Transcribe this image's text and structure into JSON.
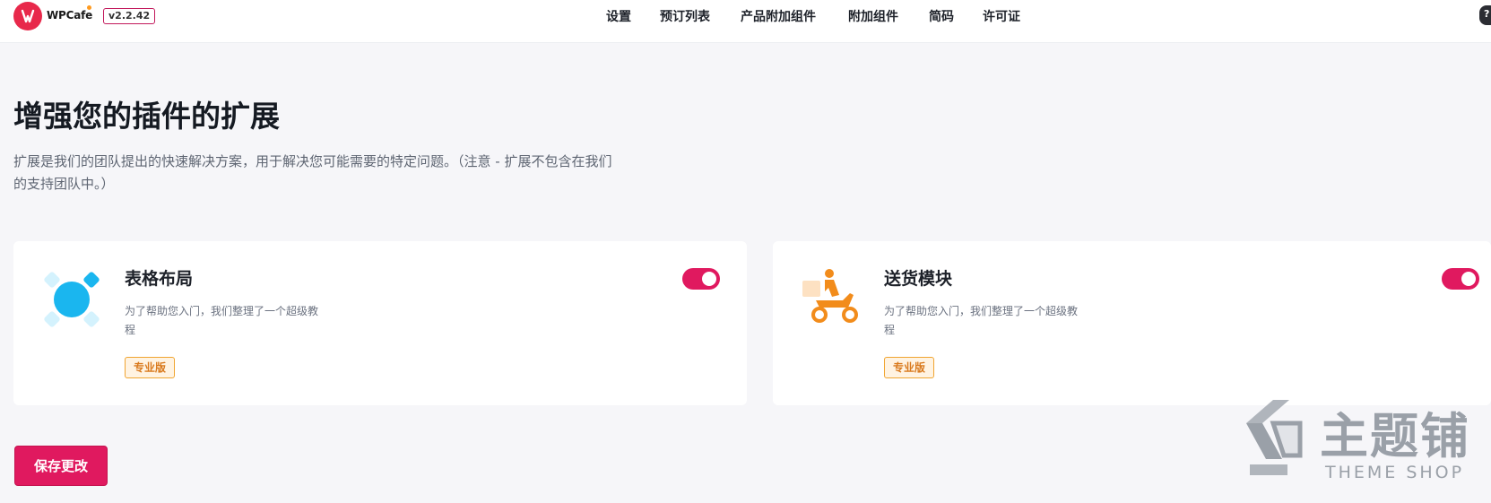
{
  "header": {
    "brand": "WPCafe",
    "version": "v2.2.42",
    "nav": [
      {
        "label": "设置"
      },
      {
        "label": "预订列表"
      },
      {
        "label": "产品附加组件"
      },
      {
        "label": "附加组件"
      },
      {
        "label": "简码"
      },
      {
        "label": "许可证"
      }
    ]
  },
  "page": {
    "title": "增强您的插件的扩展",
    "description": "扩展是我们的团队提出的快速解决方案，用于解决您可能需要的特定问题。（注意 - 扩展不包含在我们的支持团队中。）"
  },
  "extensions": [
    {
      "title": "表格布局",
      "description": "为了帮助您入门，我们整理了一个超级教程",
      "badge": "专业版",
      "enabled": true,
      "icon": "table-layout-icon"
    },
    {
      "title": "送货模块",
      "description": "为了帮助您入门，我们整理了一个超级教程",
      "badge": "专业版",
      "enabled": true,
      "icon": "delivery-scooter-icon"
    }
  ],
  "actions": {
    "save_label": "保存更改"
  },
  "watermark": {
    "text_cn": "主题铺",
    "text_en": "THEME SHOP"
  },
  "colors": {
    "accent": "#e0195f",
    "logo": "#e8294b",
    "badge_text": "#d9791c",
    "badge_border": "#f0a531",
    "table_icon": "#1ab6ef",
    "delivery_icon": "#f28c1b"
  }
}
